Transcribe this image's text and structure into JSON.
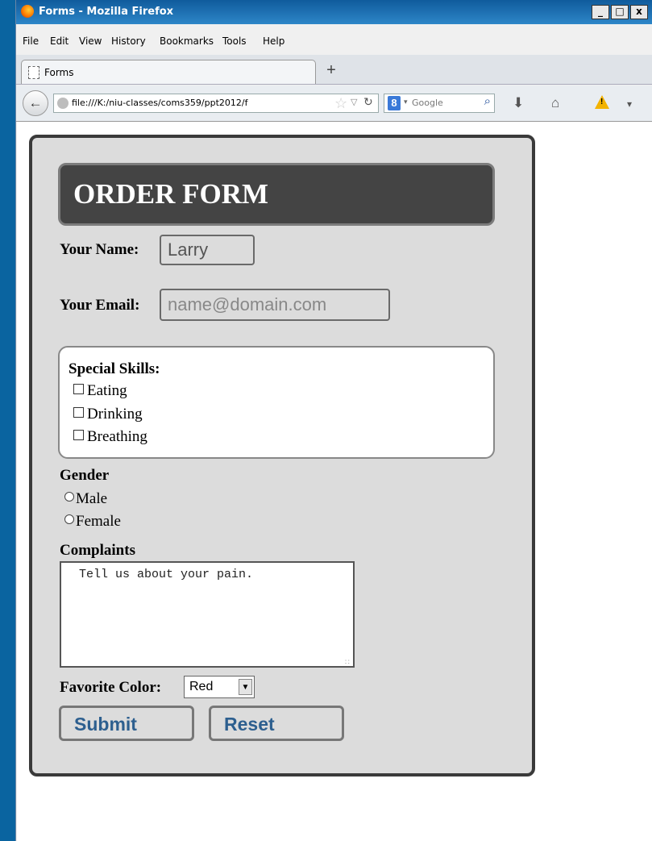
{
  "window": {
    "title": "Forms - Mozilla Firefox",
    "controls": [
      "_",
      "□",
      "x"
    ]
  },
  "menu": [
    "File",
    "Edit",
    "View",
    "History",
    "Bookmarks",
    "Tools",
    "Help"
  ],
  "tab": {
    "title": "Forms",
    "new_tab": "+"
  },
  "nav": {
    "url": "file:///K:/niu-classes/coms359/ppt2012/f",
    "search_placeholder": "Google"
  },
  "form": {
    "title": "ORDER FORM",
    "name_label": "Your Name:",
    "name_value": "Larry",
    "email_label": "Your Email:",
    "email_placeholder": "name@domain.com",
    "skills_label": "Special Skills:",
    "skills": [
      "Eating",
      "Drinking",
      "Breathing"
    ],
    "gender_label": "Gender",
    "genders": [
      "Male",
      "Female"
    ],
    "complaints_label": "Complaints",
    "complaints_value": "Tell us about your pain.",
    "color_label": "Favorite Color:",
    "color_value": "Red",
    "submit_label": "Submit",
    "reset_label": "Reset"
  }
}
